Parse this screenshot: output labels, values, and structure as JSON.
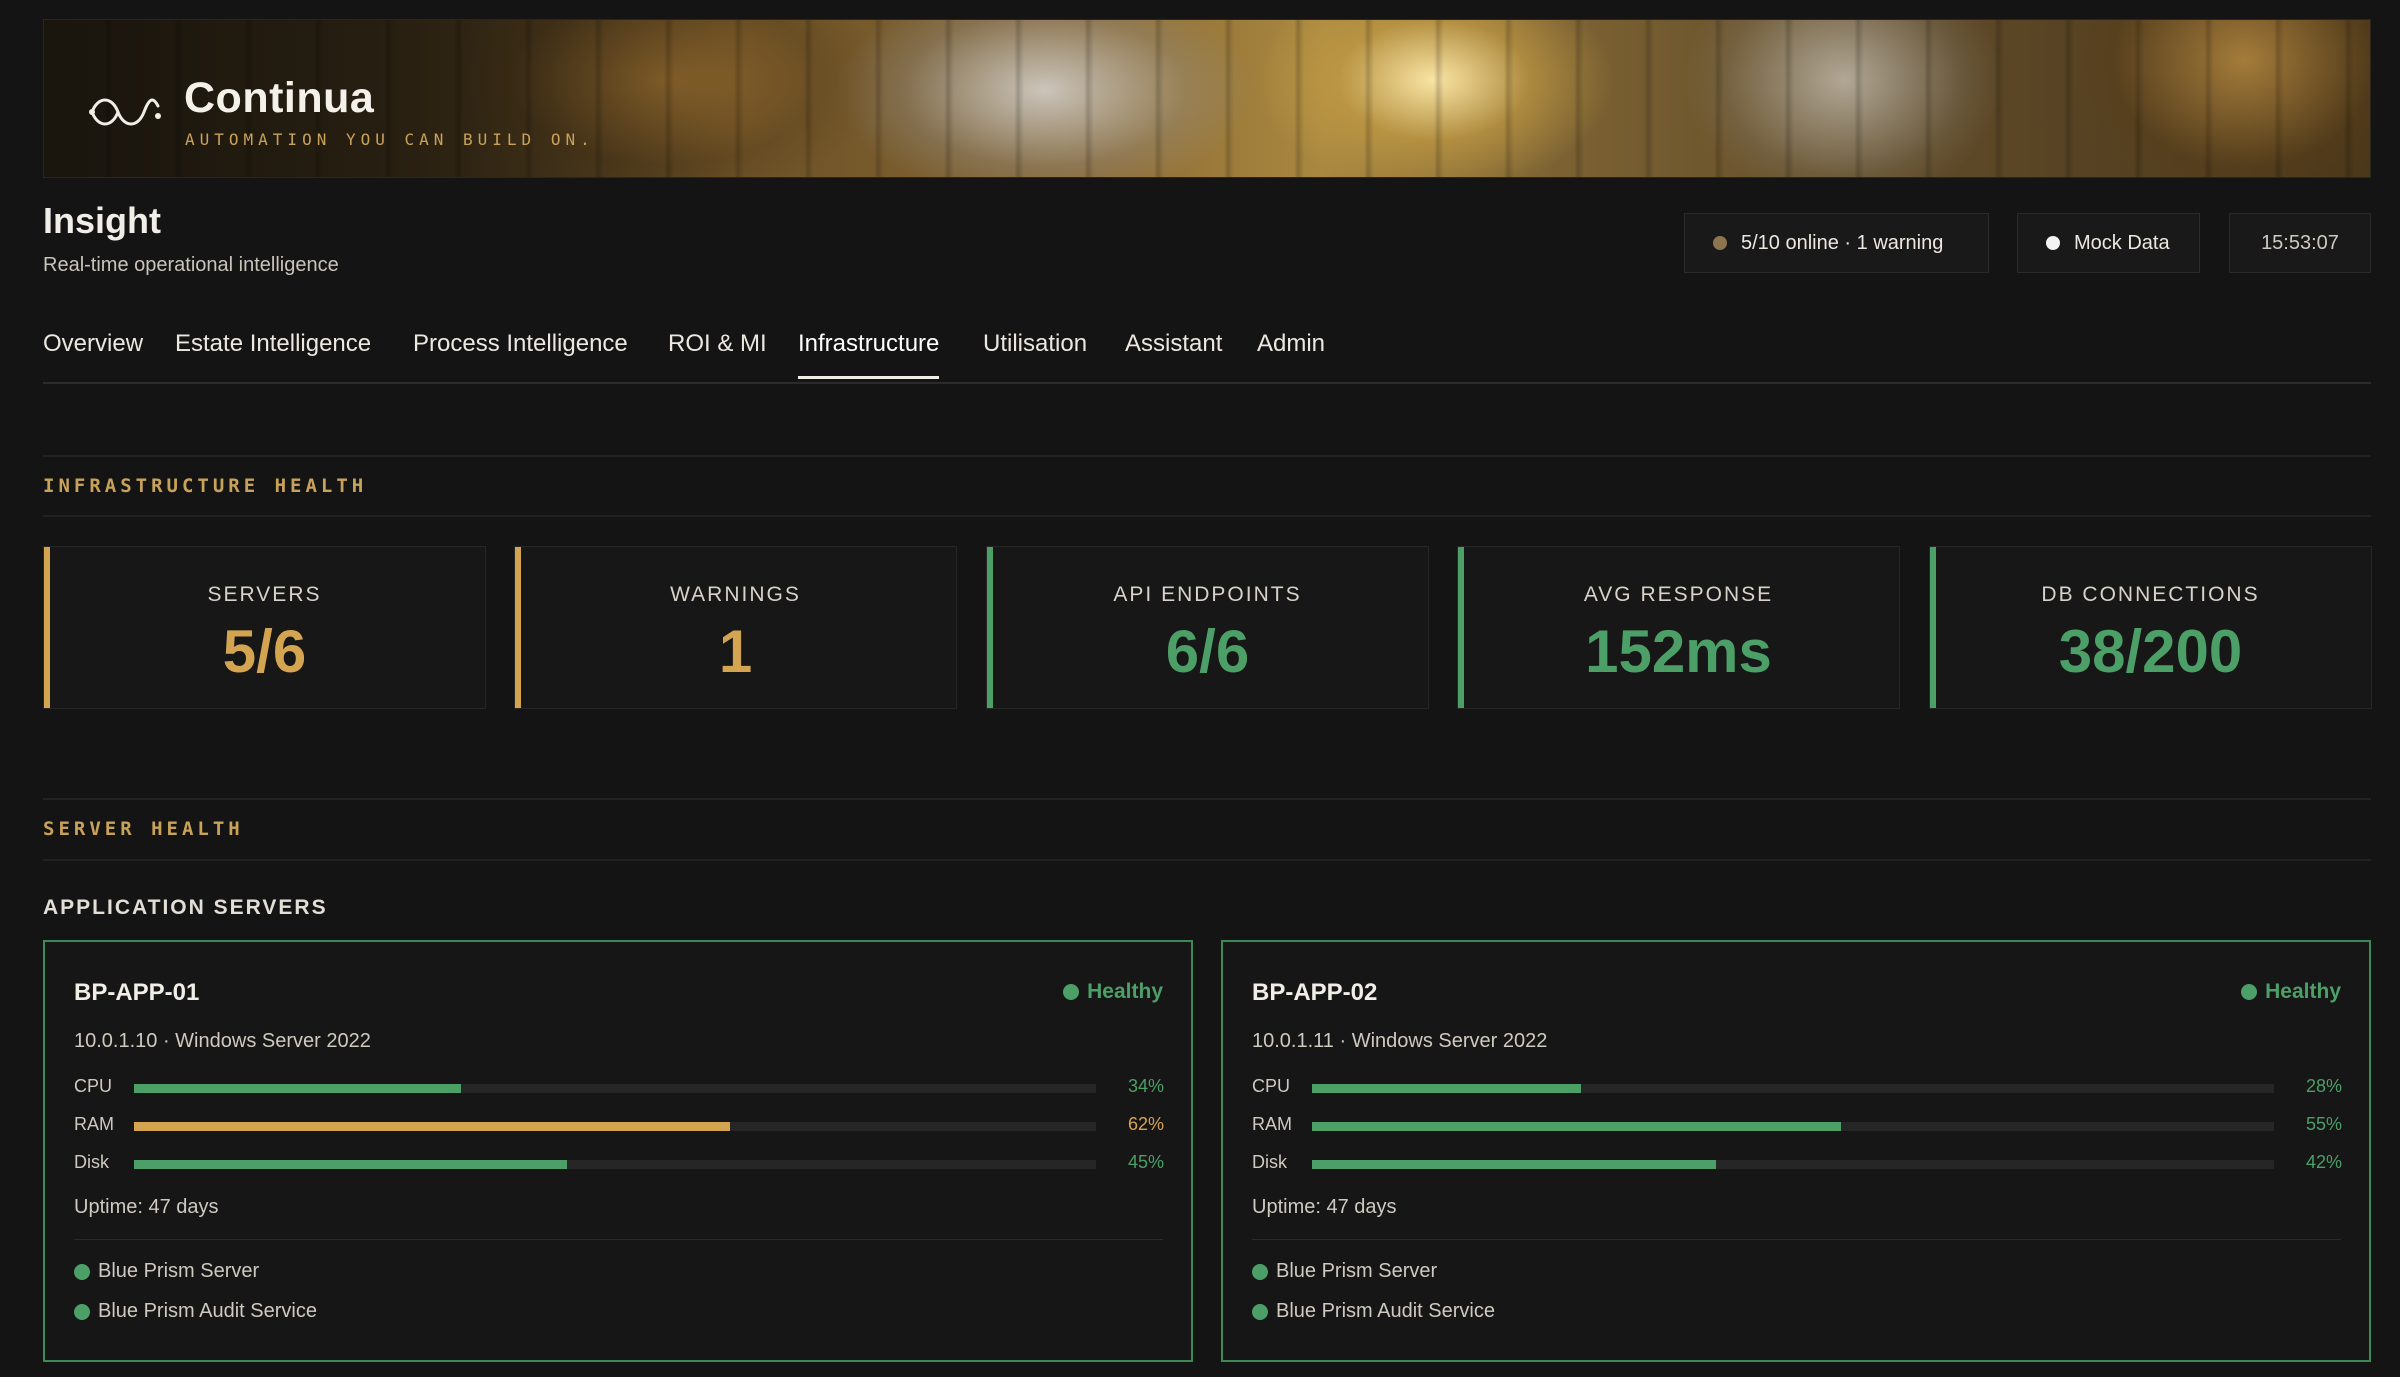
{
  "brand": {
    "name": "Continua",
    "tagline": "AUTOMATION YOU CAN BUILD ON."
  },
  "header": {
    "title": "Insight",
    "subtitle": "Real-time operational intelligence",
    "status_online": "5/10 online · 1 warning",
    "status_mock": "Mock Data",
    "time": "15:53:07"
  },
  "tabs": [
    {
      "label": "Overview"
    },
    {
      "label": "Estate Intelligence"
    },
    {
      "label": "Process Intelligence"
    },
    {
      "label": "ROI & MI"
    },
    {
      "label": "Infrastructure",
      "active": true
    },
    {
      "label": "Utilisation"
    },
    {
      "label": "Assistant"
    },
    {
      "label": "Admin"
    }
  ],
  "infrastructure_health": {
    "section_label": "INFRASTRUCTURE HEALTH",
    "kpis": [
      {
        "label": "SERVERS",
        "value": "5/6",
        "color": "#d4a551"
      },
      {
        "label": "WARNINGS",
        "value": "1",
        "color": "#d4a551"
      },
      {
        "label": "API ENDPOINTS",
        "value": "6/6",
        "color": "#4c9f67"
      },
      {
        "label": "AVG RESPONSE",
        "value": "152ms",
        "color": "#4c9f67"
      },
      {
        "label": "DB CONNECTIONS",
        "value": "38/200",
        "color": "#4c9f67"
      }
    ]
  },
  "server_health": {
    "section_label": "SERVER HEALTH",
    "group_title": "APPLICATION SERVERS",
    "servers": [
      {
        "name": "BP-APP-01",
        "status": "Healthy",
        "meta": "10.0.1.10 · Windows Server 2022",
        "metrics": [
          {
            "label": "CPU",
            "value": "34%",
            "percent": 34,
            "color": "#4c9f67"
          },
          {
            "label": "RAM",
            "value": "62%",
            "percent": 62,
            "color": "#d4a551"
          },
          {
            "label": "Disk",
            "value": "45%",
            "percent": 45,
            "color": "#4c9f67"
          }
        ],
        "uptime": "Uptime: 47 days",
        "services": [
          "Blue Prism Server",
          "Blue Prism Audit Service"
        ]
      },
      {
        "name": "BP-APP-02",
        "status": "Healthy",
        "meta": "10.0.1.11 · Windows Server 2022",
        "metrics": [
          {
            "label": "CPU",
            "value": "28%",
            "percent": 28,
            "color": "#4c9f67"
          },
          {
            "label": "RAM",
            "value": "55%",
            "percent": 55,
            "color": "#4c9f67"
          },
          {
            "label": "Disk",
            "value": "42%",
            "percent": 42,
            "color": "#4c9f67"
          }
        ],
        "uptime": "Uptime: 47 days",
        "services": [
          "Blue Prism Server",
          "Blue Prism Audit Service"
        ]
      }
    ]
  },
  "icons": {
    "logo": "infinity-wave-icon",
    "status": "status-dot-icon"
  }
}
